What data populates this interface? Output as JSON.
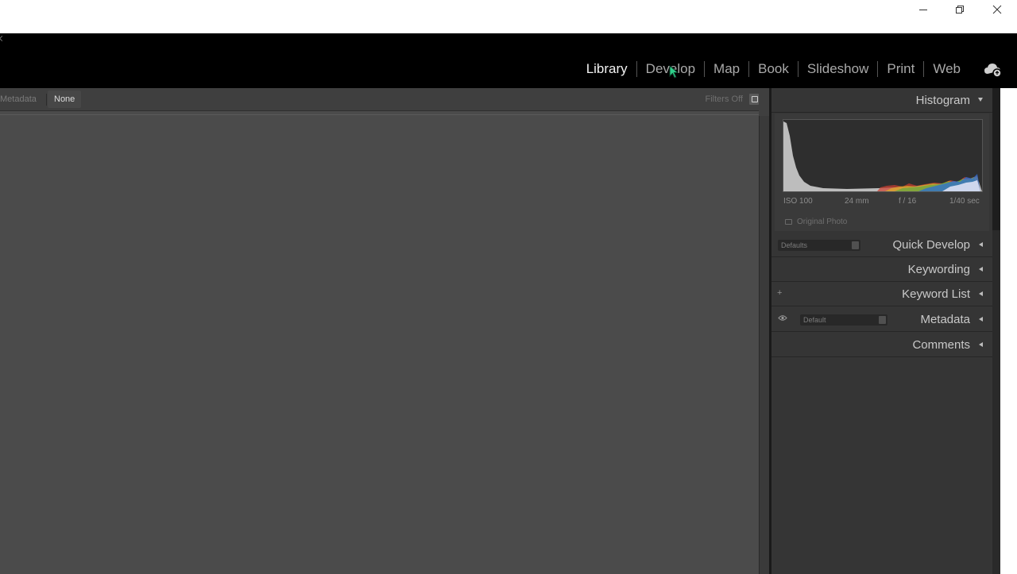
{
  "window_controls": {
    "minimize": "minimize-icon",
    "restore": "restore-icon",
    "close": "close-icon"
  },
  "modules": [
    {
      "label": "Library",
      "active": true
    },
    {
      "label": "Develop",
      "active": false
    },
    {
      "label": "Map",
      "active": false
    },
    {
      "label": "Book",
      "active": false
    },
    {
      "label": "Slideshow",
      "active": false
    },
    {
      "label": "Print",
      "active": false
    },
    {
      "label": "Web",
      "active": false
    }
  ],
  "filter_bar": {
    "metadata_label": "Metadata",
    "none_label": "None",
    "filters_off": "Filters Off"
  },
  "right_panel": {
    "histogram": {
      "title": "Histogram",
      "iso": "ISO 100",
      "focal_length": "24 mm",
      "aperture": "f / 16",
      "shutter": "1/40 sec",
      "original_photo": "Original Photo"
    },
    "quick_develop": {
      "title": "Quick Develop",
      "preset": "Defaults"
    },
    "keywording": {
      "title": "Keywording"
    },
    "keyword_list": {
      "title": "Keyword List",
      "add": "+"
    },
    "metadata": {
      "title": "Metadata",
      "preset": "Default"
    },
    "comments": {
      "title": "Comments"
    }
  },
  "colors": {
    "module_bar": "#000000",
    "content_bg": "#4b4b4b",
    "panel_bg": "#353535",
    "active_module": "#f2f2f2",
    "inactive_module": "#a9a9a9"
  }
}
